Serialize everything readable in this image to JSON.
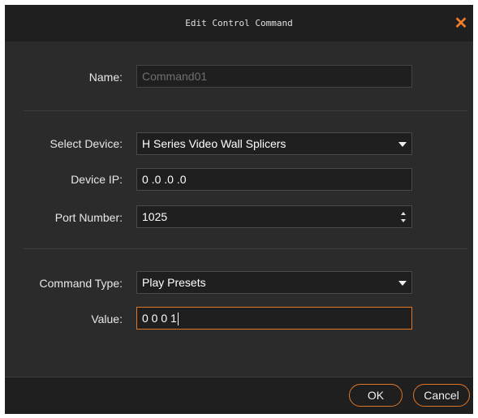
{
  "dialog": {
    "title": "Edit Control Command",
    "close_icon": "close-icon",
    "accent_color": "#e07525"
  },
  "form": {
    "name": {
      "label": "Name:",
      "placeholder": "Command01",
      "value": ""
    },
    "select_device": {
      "label": "Select Device:",
      "value": "H Series Video Wall Splicers"
    },
    "device_ip": {
      "label": "Device IP:",
      "value": "0 .0 .0 .0"
    },
    "port_number": {
      "label": "Port Number:",
      "value": "1025"
    },
    "command_type": {
      "label": "Command Type:",
      "value": "Play Presets"
    },
    "value": {
      "label": "Value:",
      "value": "0 0 0 1"
    }
  },
  "buttons": {
    "ok": "OK",
    "cancel": "Cancel"
  }
}
